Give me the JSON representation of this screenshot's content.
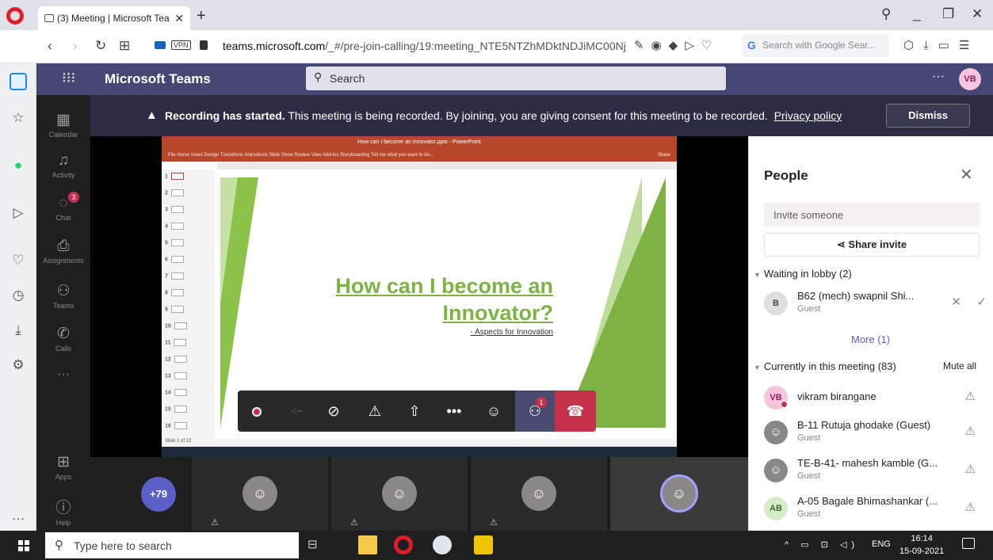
{
  "browser": {
    "tab_title": "(3) Meeting | Microsoft Tea",
    "url_host": "teams.microsoft.com",
    "url_path": "/_#/pre-join-calling/19:meeting_NTE5NTZhMDktNDJiMC00NjBh",
    "vpn_label": "VPN",
    "search_placeholder": "Search with Google Sear..."
  },
  "teams": {
    "title": "Microsoft Teams",
    "search_label": "Search",
    "more_label": "···",
    "user_initials": "VB"
  },
  "rail": {
    "items": [
      {
        "label": "Calendar",
        "icon": "calendar-icon"
      },
      {
        "label": "Activity",
        "icon": "bell-icon"
      },
      {
        "label": "Chat",
        "icon": "chat-icon",
        "badge": "3"
      },
      {
        "label": "Assignments",
        "icon": "assignments-icon"
      },
      {
        "label": "Teams",
        "icon": "teams-icon"
      },
      {
        "label": "Calls",
        "icon": "phone-icon"
      }
    ],
    "more": "···",
    "apps": "Apps",
    "help": "Help"
  },
  "banner": {
    "bold": "Recording has started.",
    "text": "This meeting is being recorded. By joining, you are giving consent for this meeting to be recorded.",
    "link": "Privacy policy",
    "dismiss": "Dismiss"
  },
  "ppt": {
    "window_title": "How can I become an Innovator.pptx - PowerPoint",
    "ribbon": "File   Home   Insert   Design   Transitions   Animations   Slide Show   Review   View   Add-ins   Storyboarding   Tell me what you want to do...",
    "share": "Share",
    "thumbs": [
      "1",
      "2",
      "3",
      "4",
      "5",
      "6",
      "7",
      "8",
      "9",
      "10",
      "11",
      "12",
      "13",
      "14",
      "15",
      "16"
    ],
    "slide_title_1": "How can I become an",
    "slide_title_2": "Innovator?",
    "slide_subtitle": "- Aspects for Innovation",
    "status": "Slide 1 of 22"
  },
  "controls": {
    "people_badge": "1"
  },
  "strip": {
    "overflow": "+79"
  },
  "people": {
    "title": "People",
    "invite_placeholder": "Invite someone",
    "share_invite": "Share invite",
    "lobby_header": "Waiting in lobby (2)",
    "lobby": [
      {
        "initials": "B",
        "name": "B62 (mech) swapnil Shi...",
        "role": "Guest"
      }
    ],
    "more": "More (1)",
    "in_meeting_header": "Currently in this meeting (83)",
    "mute_all": "Mute all",
    "participants": [
      {
        "initials": "VB",
        "name": "vikram birangane",
        "role": ""
      },
      {
        "initials": "",
        "name": "B-11 Rutuja ghodake (Guest)",
        "role": "Guest"
      },
      {
        "initials": "",
        "name": "TE-B-41- mahesh kamble (G...",
        "role": "Guest"
      },
      {
        "initials": "AB",
        "name": "A-05 Bagale Bhimashankar (...",
        "role": "Guest"
      }
    ]
  },
  "taskbar": {
    "search_placeholder": "Type here to search",
    "lang": "ENG",
    "time": "16:14",
    "date": "15-09-2021"
  }
}
